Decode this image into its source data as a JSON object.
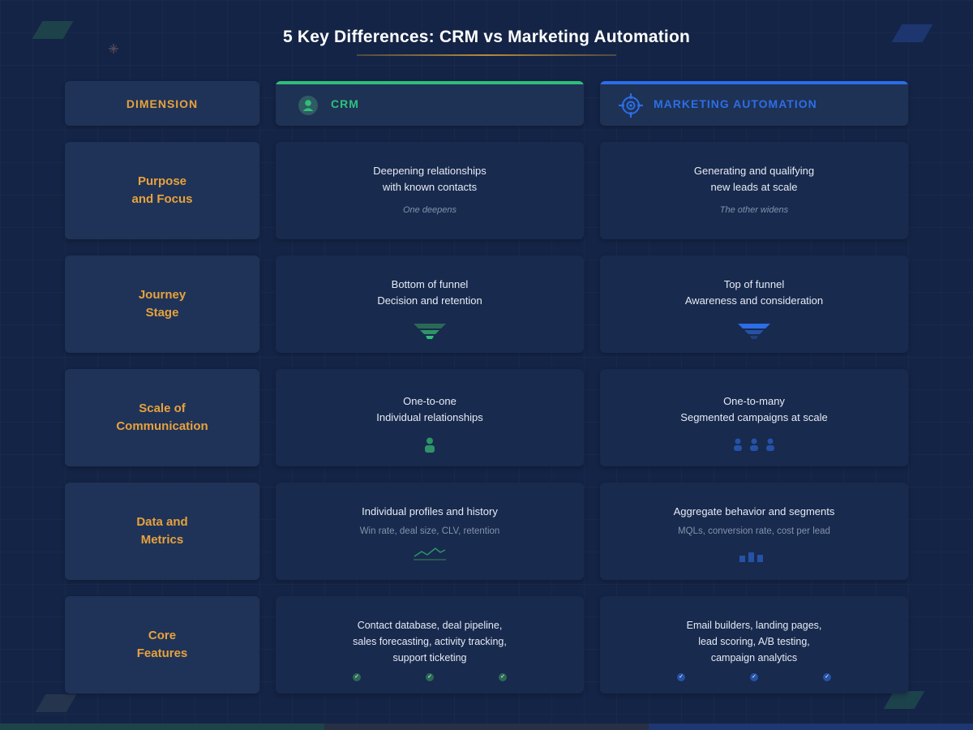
{
  "title": "5 Key Differences: CRM vs Marketing Automation",
  "colors": {
    "crm": "#2fbf7a",
    "ma": "#2c6de8",
    "label": "#e8a23c",
    "background": "#142446"
  },
  "header": {
    "dimension": "DIMENSION",
    "crm": {
      "label": "CRM",
      "icon": "user-circle-icon"
    },
    "ma": {
      "label": "MARKETING AUTOMATION",
      "icon": "target-crosshair-icon"
    }
  },
  "rows": [
    {
      "label": "Purpose\nand Focus",
      "crm": {
        "text": "Deepening relationships\nwith known contacts",
        "note": "One deepens"
      },
      "ma": {
        "text": "Generating and qualifying\nnew leads at scale",
        "note": "The other widens"
      }
    },
    {
      "label": "Journey\nStage",
      "crm": {
        "text": "Bottom of funnel\nDecision and retention",
        "icon": "funnel-icon"
      },
      "ma": {
        "text": "Top of funnel\nAwareness and consideration",
        "icon": "funnel-icon"
      }
    },
    {
      "label": "Scale of\nCommunication",
      "crm": {
        "text": "One-to-one\nIndividual relationships",
        "icon": "person-icon"
      },
      "ma": {
        "text": "One-to-many\nSegmented campaigns at scale",
        "icon": "group-icon"
      }
    },
    {
      "label": "Data and\nMetrics",
      "crm": {
        "text": "Individual profiles and history",
        "note": "Win rate, deal size, CLV, retention",
        "icon": "line-chart-icon"
      },
      "ma": {
        "text": "Aggregate behavior and segments",
        "note": "MQLs, conversion rate, cost per lead",
        "icon": "bar-chart-icon"
      }
    },
    {
      "label": "Core\nFeatures",
      "crm": {
        "text": "Contact database, deal pipeline,\nsales forecasting, activity tracking,\nsupport ticketing",
        "icon": "check-icon"
      },
      "ma": {
        "text": "Email builders, landing pages,\nlead scoring, A/B testing,\ncampaign analytics",
        "icon": "check-icon"
      }
    }
  ]
}
